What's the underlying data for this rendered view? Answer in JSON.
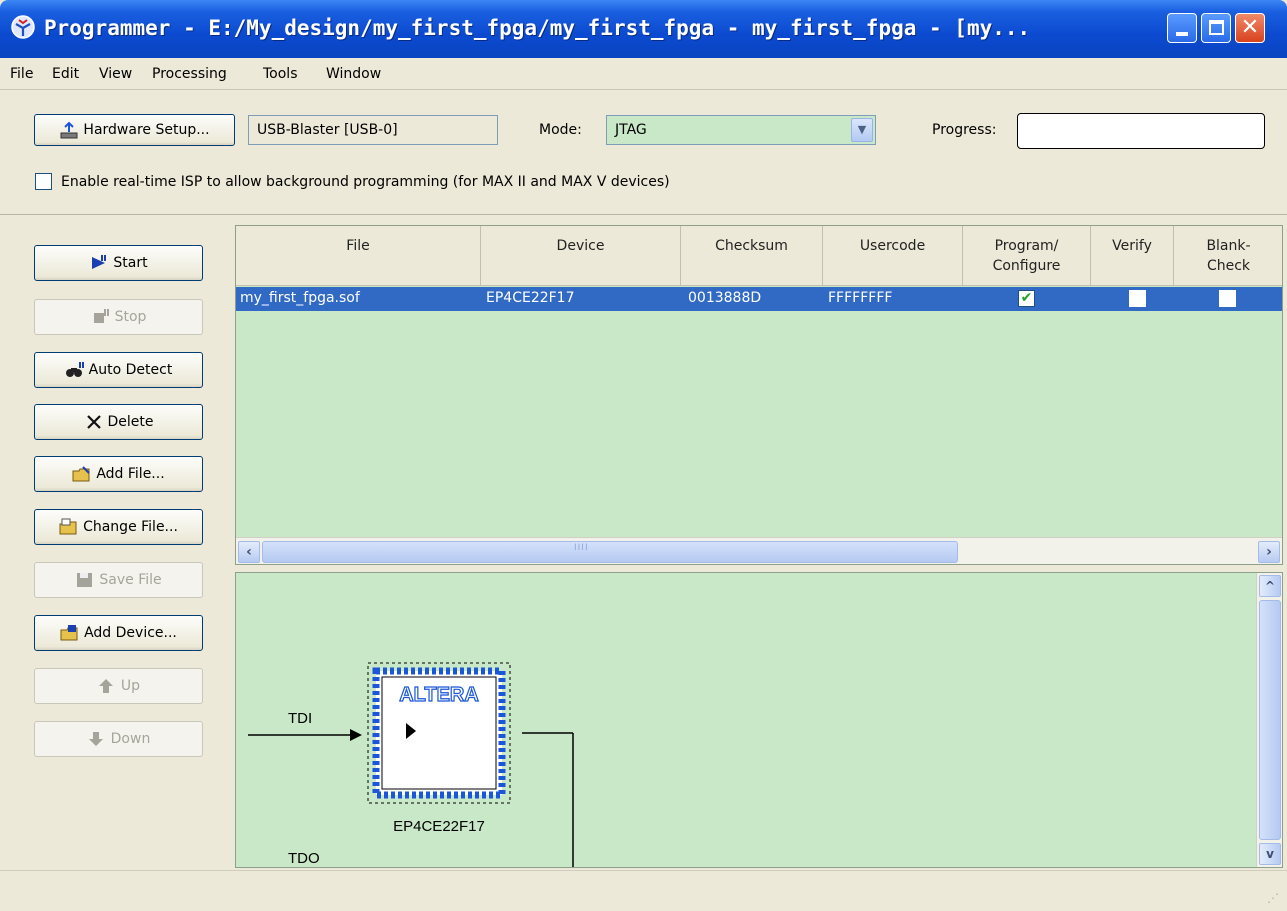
{
  "window": {
    "title": "Programmer - E:/My_design/my_first_fpga/my_first_fpga - my_first_fpga - [my...",
    "icon": "programmer-icon"
  },
  "menu": [
    {
      "label": "File"
    },
    {
      "label": "Edit"
    },
    {
      "label": "View"
    },
    {
      "label": "Processing"
    },
    {
      "label": "Tools"
    },
    {
      "label": "Window"
    }
  ],
  "toolbar": {
    "hardware_setup_label": "Hardware Setup...",
    "hardware_value": "USB-Blaster [USB-0]",
    "mode_label": "Mode:",
    "mode_value": "JTAG",
    "progress_label": "Progress:",
    "isp_label": "Enable real-time ISP to allow background programming (for MAX II and MAX V devices)",
    "isp_checked": false
  },
  "side_buttons": [
    {
      "label": "Start",
      "enabled": true,
      "icon": "start-icon"
    },
    {
      "label": "Stop",
      "enabled": false,
      "icon": "stop-icon"
    },
    {
      "label": "Auto Detect",
      "enabled": true,
      "icon": "auto-detect-icon"
    },
    {
      "label": "Delete",
      "enabled": true,
      "icon": "delete-icon"
    },
    {
      "label": "Add File...",
      "enabled": true,
      "icon": "add-file-icon"
    },
    {
      "label": "Change File...",
      "enabled": true,
      "icon": "change-file-icon"
    },
    {
      "label": "Save File",
      "enabled": false,
      "icon": "save-file-icon"
    },
    {
      "label": "Add Device...",
      "enabled": true,
      "icon": "add-device-icon"
    },
    {
      "label": "Up",
      "enabled": false,
      "icon": "up-icon"
    },
    {
      "label": "Down",
      "enabled": false,
      "icon": "down-icon"
    }
  ],
  "table": {
    "columns": [
      "File",
      "Device",
      "Checksum",
      "Usercode",
      "Program/\nConfigure",
      "Verify",
      "Blank-\nCheck"
    ],
    "rows": [
      {
        "file": "my_first_fpga.sof",
        "device": "EP4CE22F17",
        "checksum": "0013888D",
        "usercode": "FFFFFFFF",
        "program": true,
        "verify": false,
        "blank_check": false
      }
    ],
    "scroll_grip": "IIII"
  },
  "chain": {
    "tdi_label": "TDI",
    "tdo_label": "TDO",
    "chip_brand": "ALTERA",
    "device_label": "EP4CE22F17"
  },
  "colors": {
    "pane_bg": "#c8e8c8",
    "selection": "#316ac5",
    "chip_border": "#1a56d8"
  }
}
